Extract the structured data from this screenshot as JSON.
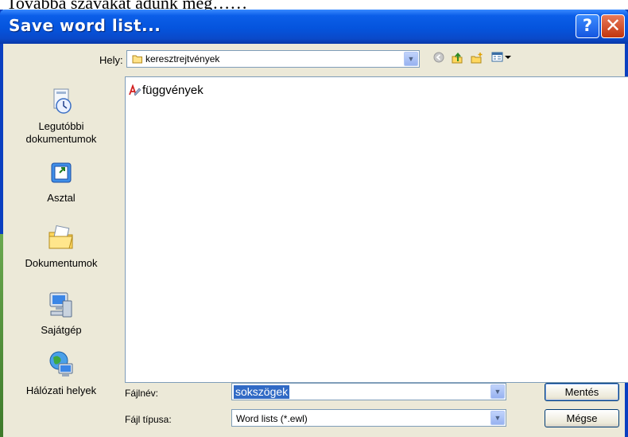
{
  "page_caption": "Továbbá szavakat adunk meg……",
  "dialog": {
    "title": "Save word list...",
    "help_glyph": "?",
    "close_glyph": "✕"
  },
  "location": {
    "label": "Hely:",
    "value": "keresztrejtvények",
    "icon": "folder-icon"
  },
  "toolbar": {
    "icons": [
      "back-icon",
      "up-folder-icon",
      "new-folder-icon",
      "view-menu-icon"
    ]
  },
  "places": [
    {
      "label": "Legutóbbi dokumentumok",
      "icon": "recent-documents-icon"
    },
    {
      "label": "Asztal",
      "icon": "desktop-icon"
    },
    {
      "label": "Dokumentumok",
      "icon": "my-documents-icon"
    },
    {
      "label": "Sajátgép",
      "icon": "my-computer-icon"
    },
    {
      "label": "Hálózati helyek",
      "icon": "network-places-icon"
    }
  ],
  "files": [
    {
      "name": "függvények",
      "icon": "wordlist-file-icon"
    }
  ],
  "form": {
    "filename_label": "Fájlnév:",
    "filename_value": "sokszögek",
    "filetype_label": "Fájl típusa:",
    "filetype_value": "Word lists (*.ewl)"
  },
  "buttons": {
    "save": "Mentés",
    "cancel": "Mégse"
  },
  "colors": {
    "titlebar": "#0554dd",
    "dialog_bg": "#ece9d8",
    "selection": "#316ac5"
  }
}
